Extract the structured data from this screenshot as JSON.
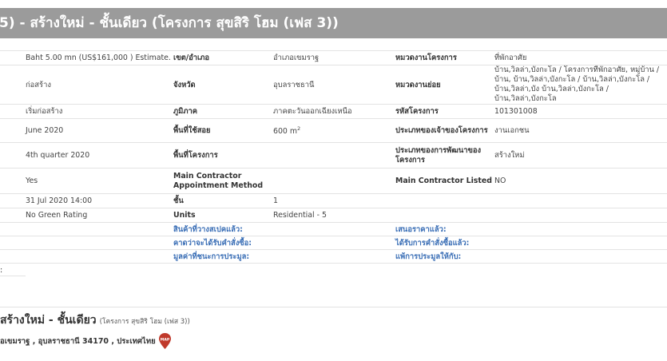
{
  "header": {
    "title": "5) - สร้างใหม่ - ชั้นเดียว  (โครงการ สุขสิริ โฮม (เฟส 3))"
  },
  "details": {
    "rows": [
      {
        "v1": "Baht 5.00 mn   (US$161,000 ) Estimate.",
        "l1": "เขต/อำเภอ",
        "v2": "อำเภอเขมราฐ",
        "l2": "หมวดงานโครงการ",
        "v3": "ที่พักอาศัย"
      },
      {
        "v1": "ก่อสร้าง",
        "l1": "จังหวัด",
        "v2": "อุบลราชธานี",
        "l2": "หมวดงานย่อย",
        "v3": "บ้าน,วิลล่า,บังกะโล / โครงการที่พักอาศัย, หมู่บ้าน / บ้าน, บ้าน,วิลล่า,บังกะโล / บ้าน,วิลล่า,บังกะโล / บ้าน,วิลล่า,บัง บ้าน,วิลล่า,บังกะโล / บ้าน,วิลล่า,บังกะโล"
      },
      {
        "v1": "เริ่มก่อสร้าง",
        "l1": "ภูมิภาค",
        "v2": "ภาคตะวันออกเฉียงเหนือ",
        "l2": "รหัสโครงการ",
        "v3": "101301008"
      },
      {
        "v1": "June 2020",
        "l1": "พื้นที่ใช้สอย",
        "v2": "600 m",
        "v2sup": "2",
        "l2": "ประเภทของเจ้าของโครงการ",
        "v3": "งานเอกชน"
      },
      {
        "v1": "4th quarter 2020",
        "l1": "พื้นที่โครงการ",
        "v2": "",
        "l2": "ประเภทของการพัฒนาของโครงการ",
        "v3": "สร้างใหม่"
      },
      {
        "v1": "Yes",
        "l1": "Main Contractor Appointment Method",
        "v2": "",
        "l2": "Main Contractor Listed",
        "v3": "NO"
      },
      {
        "v1": "31 Jul 2020 14:00",
        "l1": "ชั้น",
        "v2": "1",
        "l2": "",
        "v3": ""
      },
      {
        "v1": "No Green Rating",
        "l1": "Units",
        "v2": "Residential - 5",
        "l2": "",
        "v3": ""
      }
    ],
    "links": [
      {
        "l1": "สินค้าที่วางสเปคแล้ว:",
        "l2": "เสนอราคาแล้ว:"
      },
      {
        "l1": "คาดว่าจะได้รับคำสั่งซื้อ:",
        "l2": "ได้รับการคำสั่งซื้อแล้ว:"
      },
      {
        "l1": "มูลค่าที่ชนะการประมูล:",
        "l2": "แพ้การประมูลให้กับ:"
      }
    ],
    "colon": ":"
  },
  "project": {
    "title": " สร้างใหม่ - ชั้นเดียว",
    "subtitle": "(โครงการ สุขสิริ โฮม (เฟส 3))",
    "address": "อเขมราฐ , อุบลราชธานี 34170 , ประเทศไทย",
    "map_label": "MAP"
  },
  "colors": {
    "title_bar": "#9b9b9b",
    "link": "#3b6fb6",
    "map_pin": "#c0392b"
  }
}
